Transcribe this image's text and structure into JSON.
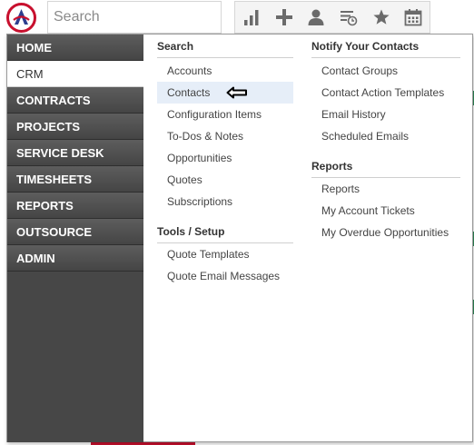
{
  "search": {
    "placeholder": "Search"
  },
  "toolbar": {
    "icons": [
      "bar-chart-icon",
      "plus-icon",
      "user-icon",
      "list-clock-icon",
      "star-icon",
      "calendar-icon"
    ]
  },
  "colors": {
    "nav_background": "#474747",
    "hover_row": "#e6eef8",
    "brand_red": "#c8102e",
    "brand_blue": "#2d3e8f"
  },
  "left_nav": {
    "items": [
      {
        "label": "HOME"
      },
      {
        "label": "CRM",
        "active": true
      },
      {
        "label": "CONTRACTS"
      },
      {
        "label": "PROJECTS"
      },
      {
        "label": "SERVICE DESK"
      },
      {
        "label": "TIMESHEETS"
      },
      {
        "label": "REPORTS"
      },
      {
        "label": "OUTSOURCE"
      },
      {
        "label": "ADMIN"
      }
    ]
  },
  "col1": {
    "search": {
      "header": "Search",
      "links": [
        "Accounts",
        "Contacts",
        "Configuration Items",
        "To-Dos & Notes",
        "Opportunities",
        "Quotes",
        "Subscriptions"
      ]
    },
    "tools": {
      "header": "Tools / Setup",
      "links": [
        "Quote Templates",
        "Quote Email Messages"
      ]
    }
  },
  "col2": {
    "notify": {
      "header": "Notify Your Contacts",
      "links": [
        "Contact Groups",
        "Contact Action Templates",
        "Email History",
        "Scheduled Emails"
      ]
    },
    "reports": {
      "header": "Reports",
      "links": [
        "Reports",
        "My Account Tickets",
        "My Overdue Opportunities"
      ]
    }
  }
}
